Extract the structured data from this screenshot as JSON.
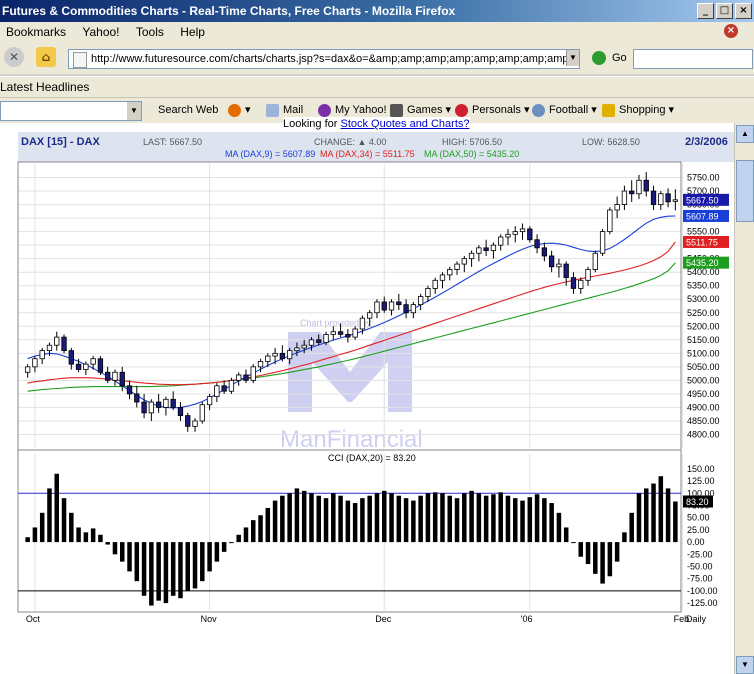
{
  "window": {
    "title": "Futures & Commodities Charts - Real-Time Charts, Free Charts - Mozilla Firefox",
    "buttons": [
      "_",
      "□",
      "×"
    ]
  },
  "menu": [
    "Bookmarks",
    "Yahoo!",
    "Tools",
    "Help"
  ],
  "nav": {
    "url": "http://www.futuresource.com/charts/charts.jsp?s=dax&o=&amp;amp;amp;amp;amp;amp;amp;amp;amp;a=D",
    "go_label": "Go"
  },
  "headlines_label": "Latest Headlines",
  "yahoo_toolbar": {
    "items": [
      "Search Web",
      "Mail",
      "My Yahoo!",
      "Games",
      "Personals",
      "Football",
      "Shopping"
    ]
  },
  "page": {
    "looking_prefix": "Looking for ",
    "looking_link": "Stock Quotes and Charts?"
  },
  "chart_header": {
    "symbol": "DAX [15] - DAX",
    "last": "LAST: 5667.50",
    "change": "CHANGE: ▲ 4.00",
    "high": "HIGH: 5706.50",
    "low": "LOW: 5628.50",
    "date": "2/3/2006",
    "ma9": "MA (DAX,9) = 5607.89",
    "ma34": "MA (DAX,34) = 5511.75",
    "ma50": "MA (DAX,50) = 5435.20",
    "cci": "CCI (DAX,20) = 83.20",
    "watermark_line": "Chart provided by:",
    "watermark_brand": "ManFinancial"
  },
  "chart_data": {
    "type": "candlestick",
    "periodicity": "Daily",
    "price_ylim": [
      4750,
      5800
    ],
    "price_ticks": [
      4800,
      4850,
      4900,
      4950,
      5000,
      5050,
      5100,
      5150,
      5200,
      5250,
      5300,
      5350,
      5400,
      5450,
      5500,
      5550,
      5600,
      5650,
      5700,
      5750
    ],
    "price_tick_labels": [
      "4800.00",
      "4850.00",
      "4900.00",
      "4950.00",
      "5000.00",
      "5050.00",
      "5100.00",
      "5150.00",
      "5200.00",
      "5250.00",
      "5300.00",
      "5350.00",
      "5400.00",
      "5450.00",
      "5500.00",
      "5550.00",
      "5600.00",
      "5650.00",
      "5700.00",
      "5750.00"
    ],
    "last_price_tags": [
      {
        "label": "5667.50",
        "value": 5667.5,
        "color": "#1a1aaa"
      },
      {
        "label": "5607.89",
        "value": 5607.89,
        "color": "#1a3fd6"
      },
      {
        "label": "5511.75",
        "value": 5511.75,
        "color": "#e02020"
      },
      {
        "label": "5435.20",
        "value": 5435.2,
        "color": "#1e9e1e"
      }
    ],
    "x_labels": [
      "Oct",
      "Nov",
      "Dec",
      "'06",
      "Feb"
    ],
    "x_label_bar_index": [
      1,
      25,
      49,
      69,
      90
    ],
    "candles": [
      [
        5030,
        5060,
        5010,
        5050
      ],
      [
        5050,
        5090,
        5030,
        5080
      ],
      [
        5080,
        5120,
        5060,
        5110
      ],
      [
        5110,
        5140,
        5090,
        5130
      ],
      [
        5130,
        5180,
        5110,
        5160
      ],
      [
        5160,
        5170,
        5100,
        5110
      ],
      [
        5110,
        5120,
        5040,
        5060
      ],
      [
        5060,
        5080,
        5030,
        5040
      ],
      [
        5040,
        5070,
        5020,
        5060
      ],
      [
        5060,
        5090,
        5040,
        5080
      ],
      [
        5080,
        5090,
        5020,
        5030
      ],
      [
        5030,
        5050,
        4990,
        5000
      ],
      [
        5000,
        5040,
        4980,
        5030
      ],
      [
        5030,
        5050,
        4960,
        4980
      ],
      [
        4980,
        5000,
        4930,
        4950
      ],
      [
        4950,
        4980,
        4900,
        4920
      ],
      [
        4920,
        4950,
        4860,
        4880
      ],
      [
        4880,
        4930,
        4850,
        4920
      ],
      [
        4920,
        4950,
        4880,
        4900
      ],
      [
        4900,
        4940,
        4870,
        4930
      ],
      [
        4930,
        4960,
        4890,
        4900
      ],
      [
        4900,
        4920,
        4850,
        4870
      ],
      [
        4870,
        4880,
        4810,
        4830
      ],
      [
        4830,
        4860,
        4810,
        4850
      ],
      [
        4850,
        4920,
        4840,
        4910
      ],
      [
        4910,
        4950,
        4890,
        4940
      ],
      [
        4940,
        4990,
        4920,
        4980
      ],
      [
        4980,
        5000,
        4950,
        4960
      ],
      [
        4960,
        5010,
        4950,
        5000
      ],
      [
        5000,
        5030,
        4980,
        5020
      ],
      [
        5020,
        5040,
        4990,
        5000
      ],
      [
        5000,
        5060,
        4990,
        5050
      ],
      [
        5050,
        5080,
        5030,
        5070
      ],
      [
        5070,
        5100,
        5050,
        5090
      ],
      [
        5090,
        5120,
        5060,
        5100
      ],
      [
        5100,
        5130,
        5070,
        5080
      ],
      [
        5080,
        5120,
        5060,
        5110
      ],
      [
        5110,
        5140,
        5090,
        5120
      ],
      [
        5120,
        5150,
        5100,
        5130
      ],
      [
        5130,
        5160,
        5110,
        5150
      ],
      [
        5150,
        5170,
        5130,
        5140
      ],
      [
        5140,
        5180,
        5130,
        5170
      ],
      [
        5170,
        5200,
        5150,
        5180
      ],
      [
        5180,
        5210,
        5160,
        5170
      ],
      [
        5170,
        5190,
        5140,
        5160
      ],
      [
        5160,
        5200,
        5150,
        5190
      ],
      [
        5190,
        5240,
        5170,
        5230
      ],
      [
        5230,
        5260,
        5200,
        5250
      ],
      [
        5250,
        5300,
        5230,
        5290
      ],
      [
        5290,
        5310,
        5250,
        5260
      ],
      [
        5260,
        5300,
        5240,
        5290
      ],
      [
        5290,
        5320,
        5260,
        5280
      ],
      [
        5280,
        5300,
        5230,
        5250
      ],
      [
        5250,
        5290,
        5230,
        5280
      ],
      [
        5280,
        5320,
        5260,
        5310
      ],
      [
        5310,
        5350,
        5290,
        5340
      ],
      [
        5340,
        5380,
        5320,
        5370
      ],
      [
        5370,
        5400,
        5340,
        5390
      ],
      [
        5390,
        5420,
        5370,
        5410
      ],
      [
        5410,
        5440,
        5390,
        5430
      ],
      [
        5430,
        5460,
        5400,
        5450
      ],
      [
        5450,
        5480,
        5420,
        5470
      ],
      [
        5470,
        5500,
        5440,
        5490
      ],
      [
        5490,
        5520,
        5460,
        5480
      ],
      [
        5480,
        5510,
        5450,
        5500
      ],
      [
        5500,
        5540,
        5480,
        5530
      ],
      [
        5530,
        5560,
        5500,
        5540
      ],
      [
        5540,
        5570,
        5510,
        5550
      ],
      [
        5550,
        5580,
        5520,
        5560
      ],
      [
        5560,
        5570,
        5510,
        5520
      ],
      [
        5520,
        5540,
        5470,
        5490
      ],
      [
        5490,
        5510,
        5440,
        5460
      ],
      [
        5460,
        5480,
        5400,
        5420
      ],
      [
        5420,
        5450,
        5380,
        5430
      ],
      [
        5430,
        5440,
        5350,
        5380
      ],
      [
        5380,
        5400,
        5320,
        5340
      ],
      [
        5340,
        5380,
        5320,
        5370
      ],
      [
        5370,
        5420,
        5350,
        5410
      ],
      [
        5410,
        5480,
        5400,
        5470
      ],
      [
        5470,
        5560,
        5460,
        5550
      ],
      [
        5550,
        5640,
        5540,
        5630
      ],
      [
        5630,
        5680,
        5600,
        5650
      ],
      [
        5650,
        5720,
        5630,
        5700
      ],
      [
        5700,
        5740,
        5660,
        5690
      ],
      [
        5690,
        5760,
        5670,
        5740
      ],
      [
        5740,
        5770,
        5680,
        5700
      ],
      [
        5700,
        5720,
        5630,
        5650
      ],
      [
        5650,
        5700,
        5630,
        5690
      ],
      [
        5690,
        5710,
        5640,
        5660
      ],
      [
        5663.5,
        5706.5,
        5628.5,
        5667.5
      ]
    ],
    "ma9": [
      5080,
      5090,
      5095,
      5100,
      5098,
      5090,
      5080,
      5070,
      5058,
      5045,
      5030,
      5015,
      4998,
      4980,
      4962,
      4945,
      4928,
      4915,
      4905,
      4900,
      4898,
      4900,
      4905,
      4912,
      4922,
      4935,
      4950,
      4966,
      4982,
      4998,
      5012,
      5027,
      5041,
      5055,
      5068,
      5080,
      5091,
      5102,
      5112,
      5122,
      5131,
      5140,
      5149,
      5157,
      5165,
      5173,
      5182,
      5192,
      5203,
      5214,
      5226,
      5239,
      5252,
      5265,
      5279,
      5293,
      5308,
      5323,
      5339,
      5355,
      5371,
      5387,
      5403,
      5418,
      5432,
      5446,
      5460,
      5473,
      5485,
      5495,
      5502,
      5506,
      5507,
      5505,
      5500,
      5492,
      5484,
      5478,
      5476,
      5479,
      5488,
      5503,
      5521,
      5541,
      5562,
      5581,
      5595,
      5603,
      5607,
      5607.89
    ],
    "ma34": [
      4990,
      4995,
      4998,
      5002,
      5005,
      5008,
      5010,
      5010,
      5010,
      5009,
      5007,
      5005,
      5002,
      4999,
      4996,
      4993,
      4990,
      4988,
      4986,
      4985,
      4984,
      4984,
      4985,
      4986,
      4988,
      4990,
      4993,
      4996,
      5000,
      5004,
      5008,
      5013,
      5018,
      5024,
      5030,
      5036,
      5043,
      5050,
      5057,
      5064,
      5072,
      5080,
      5088,
      5096,
      5104,
      5112,
      5121,
      5130,
      5139,
      5148,
      5157,
      5166,
      5175,
      5184,
      5193,
      5202,
      5211,
      5220,
      5229,
      5238,
      5247,
      5256,
      5265,
      5274,
      5283,
      5292,
      5301,
      5310,
      5319,
      5328,
      5336,
      5344,
      5351,
      5358,
      5364,
      5370,
      5376,
      5381,
      5386,
      5391,
      5396,
      5402,
      5408,
      5415,
      5423,
      5432,
      5443,
      5457,
      5477,
      5511.75
    ],
    "ma50": [
      4960,
      4963,
      4966,
      4968,
      4970,
      4972,
      4974,
      4975,
      4976,
      4977,
      4977,
      4977,
      4977,
      4977,
      4977,
      4977,
      4977,
      4977,
      4978,
      4979,
      4980,
      4982,
      4984,
      4986,
      4988,
      4990,
      4993,
      4996,
      4999,
      5002,
      5005,
      5009,
      5013,
      5017,
      5021,
      5025,
      5030,
      5035,
      5040,
      5045,
      5050,
      5056,
      5062,
      5068,
      5074,
      5080,
      5087,
      5094,
      5101,
      5108,
      5115,
      5122,
      5129,
      5136,
      5143,
      5150,
      5157,
      5164,
      5171,
      5178,
      5185,
      5192,
      5199,
      5206,
      5213,
      5220,
      5227,
      5234,
      5241,
      5248,
      5255,
      5262,
      5269,
      5276,
      5283,
      5290,
      5297,
      5304,
      5311,
      5318,
      5325,
      5332,
      5340,
      5348,
      5357,
      5366,
      5376,
      5388,
      5405,
      5435.2
    ],
    "cci_ylim": [
      -135,
      160
    ],
    "cci_ticks": [
      -125,
      -100,
      -75,
      -50,
      -25,
      0,
      25,
      50,
      75,
      100,
      125,
      150
    ],
    "cci_tick_labels": [
      "-125.00",
      "-100.00",
      "-75.00",
      "-50.00",
      "-25.00",
      "0.00",
      "25.00",
      "50.00",
      "75.00",
      "100.00",
      "125.00",
      "150.00"
    ],
    "cci_last_label": "83.20",
    "cci_lines": [
      100,
      -100
    ],
    "cci": [
      10,
      30,
      60,
      110,
      140,
      90,
      60,
      30,
      20,
      28,
      15,
      -5,
      -25,
      -40,
      -60,
      -80,
      -110,
      -130,
      -120,
      -125,
      -110,
      -115,
      -100,
      -95,
      -80,
      -60,
      -40,
      -20,
      0,
      15,
      30,
      45,
      55,
      70,
      85,
      95,
      100,
      110,
      105,
      100,
      95,
      90,
      100,
      95,
      85,
      80,
      90,
      95,
      100,
      105,
      100,
      95,
      90,
      85,
      95,
      100,
      102,
      100,
      95,
      90,
      100,
      105,
      100,
      95,
      98,
      102,
      95,
      90,
      85,
      92,
      98,
      90,
      80,
      60,
      30,
      0,
      -30,
      -45,
      -65,
      -85,
      -70,
      -40,
      20,
      60,
      100,
      110,
      120,
      135,
      110,
      83.2
    ]
  }
}
